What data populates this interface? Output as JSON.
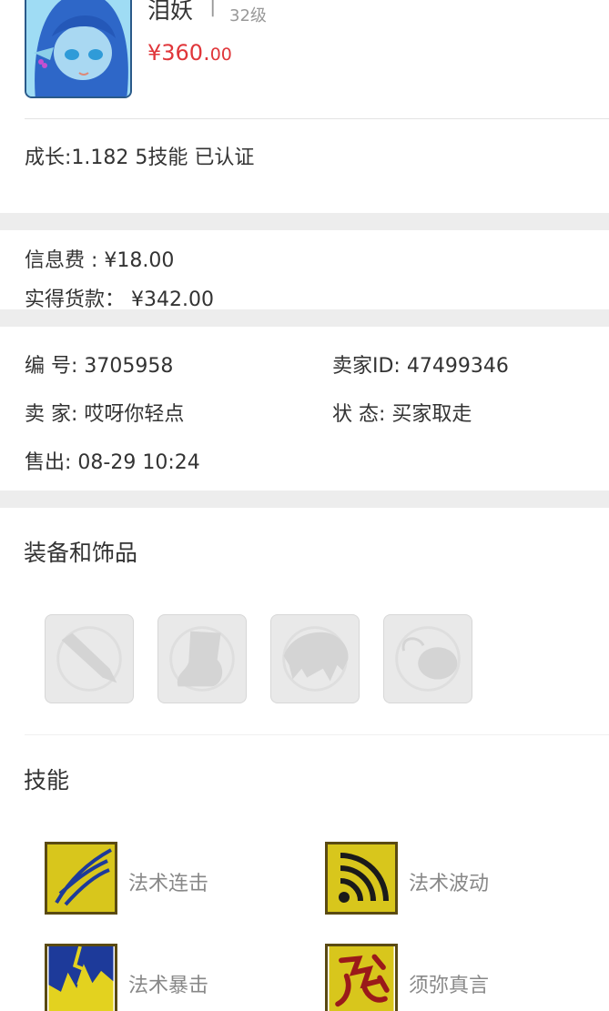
{
  "header": {
    "pet_name": "泪妖",
    "separator": "|",
    "level": "32级",
    "price_main": "¥360.",
    "price_cents": "00"
  },
  "summary": {
    "attributes": "成长:1.182 5技能 已认证"
  },
  "fees": {
    "info_fee": "信息费 : ¥18.00",
    "net_payment": "实得货款： ¥342.00"
  },
  "order": {
    "number": "编  号: 3705958",
    "seller_id": "卖家ID: 47499346",
    "seller": "卖  家: 哎呀你轻点",
    "status": "状  态: 买家取走",
    "sold_time": "售出: 08-29 10:24"
  },
  "equipment": {
    "title": "装备和饰品",
    "slots": [
      "weapon-icon",
      "boots-icon",
      "armor-icon",
      "accessory-icon"
    ]
  },
  "skills": {
    "title": "技能",
    "items": [
      {
        "label": "法术连击",
        "icon": "spell-combo-icon"
      },
      {
        "label": "法术波动",
        "icon": "spell-wave-icon"
      },
      {
        "label": "法术暴击",
        "icon": "spell-crit-icon"
      },
      {
        "label": "须弥真言",
        "icon": "sumeru-mantra-icon"
      }
    ]
  },
  "colors": {
    "price_red": "#e0363a",
    "band_gray": "#ededed",
    "skill_yellow": "#d9c81a"
  }
}
